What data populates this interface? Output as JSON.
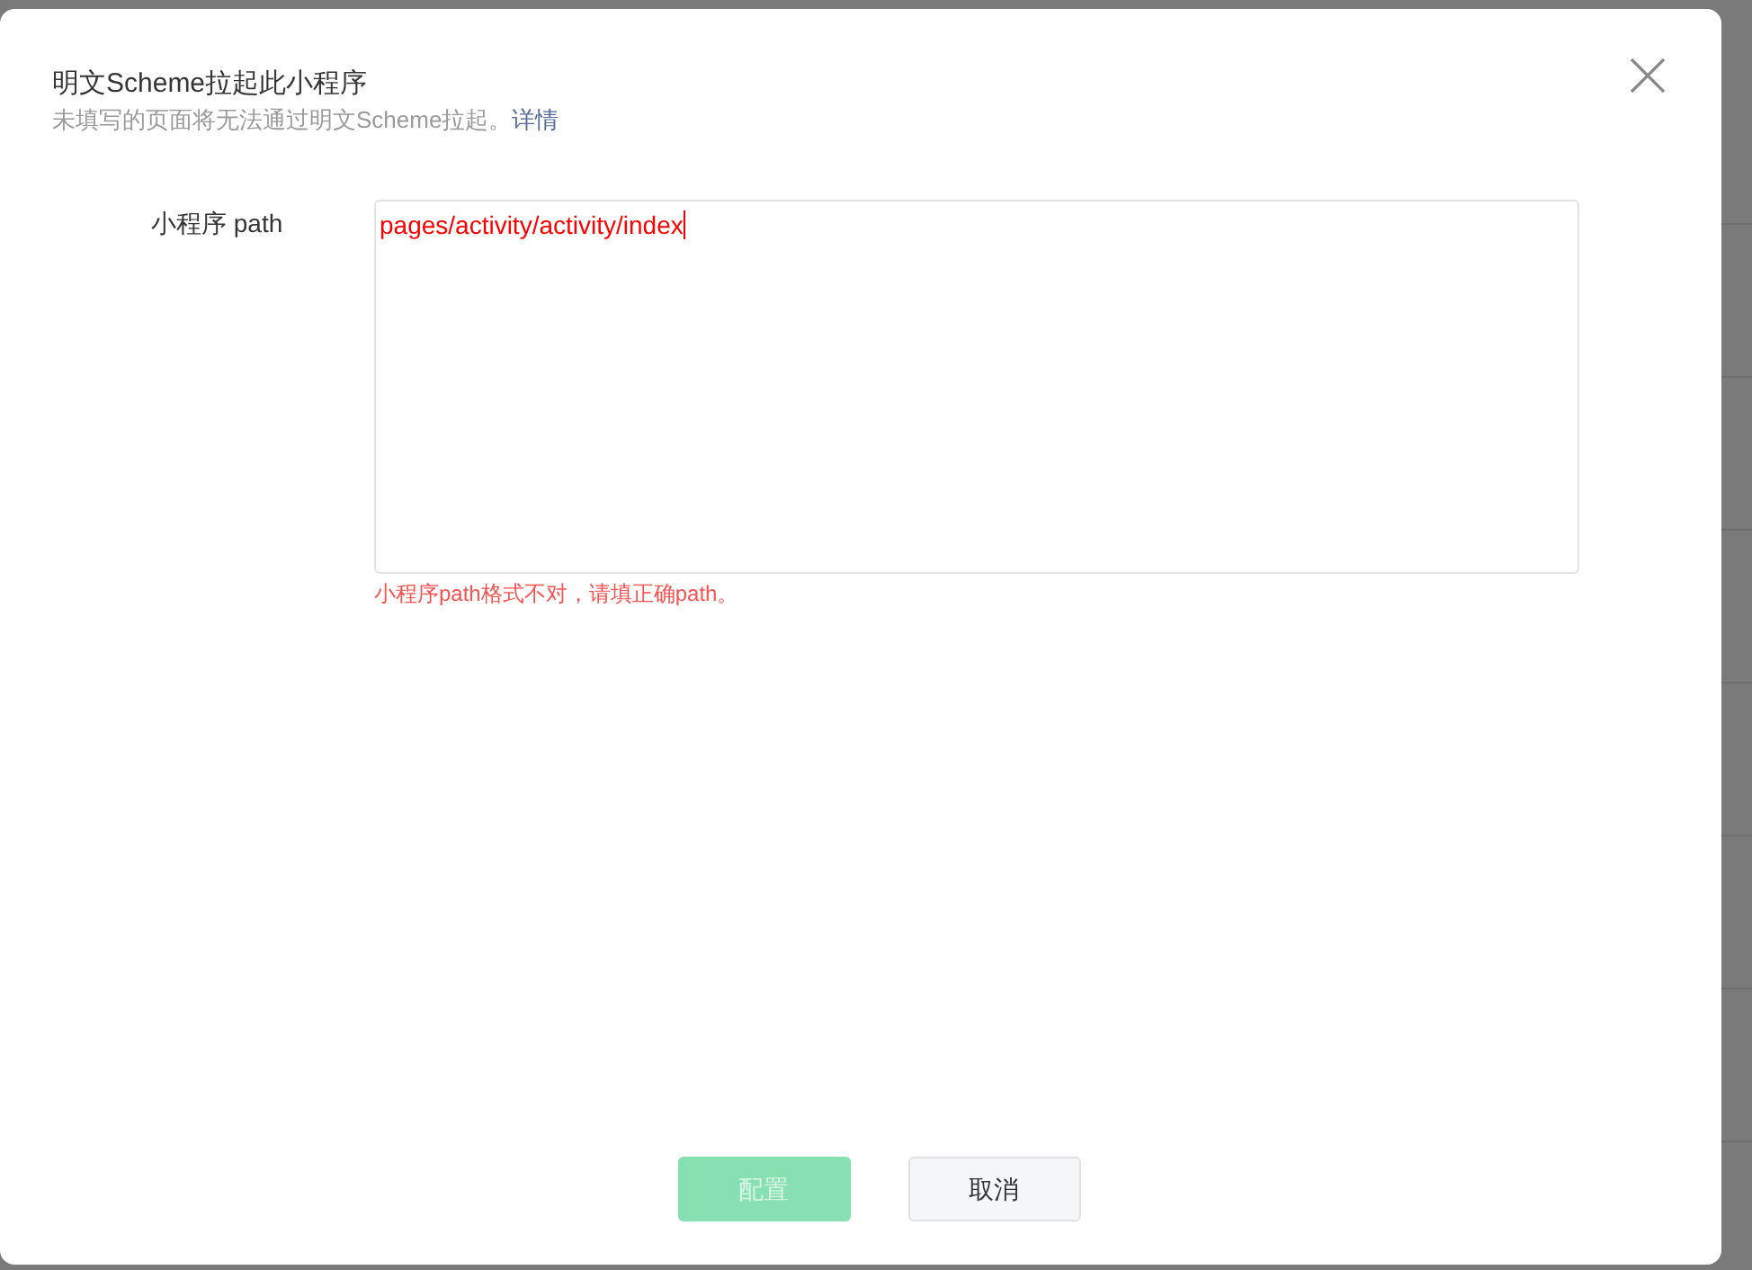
{
  "dialog": {
    "title": "明文Scheme拉起此小程序",
    "subtitle": "未填写的页面将无法通过明文Scheme拉起。",
    "subtitle_link": "详情",
    "field": {
      "label": "小程序 path",
      "value": "pages/activity/activity/index",
      "invalid": true,
      "error": "小程序path格式不对，请填正确path。"
    },
    "buttons": [
      {
        "label": "配置",
        "kind": "primary",
        "disabled": true
      },
      {
        "label": "取消",
        "kind": "secondary",
        "disabled": false
      }
    ]
  }
}
